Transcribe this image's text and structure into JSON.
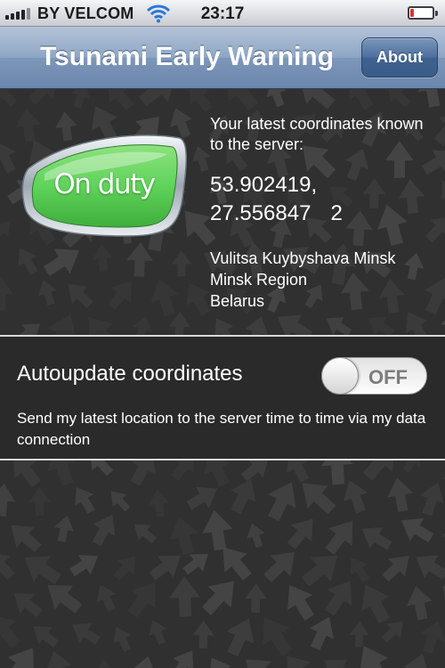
{
  "status_bar": {
    "carrier": "BY VELCOM",
    "time": "23:17",
    "signal_bars": 4,
    "battery_level": 0.15,
    "battery_color": "#d23a32"
  },
  "nav": {
    "title": "Tsunami Early Warning",
    "about_label": "About"
  },
  "status_button": {
    "label": "On duty",
    "color": "#5fd35a"
  },
  "location": {
    "caption": "Your latest coordinates known to the server:",
    "latitude": "53.902419,",
    "longitude": "27.556847",
    "accuracy": "2",
    "address_line1": "Vulitsa Kuybyshava Minsk",
    "address_line2": "Minsk Region",
    "address_line3": "Belarus"
  },
  "autoupdate": {
    "title": "Autoupdate coordinates",
    "toggle_state": "OFF",
    "description": "Send my latest location to the server time to time via my data connection"
  }
}
